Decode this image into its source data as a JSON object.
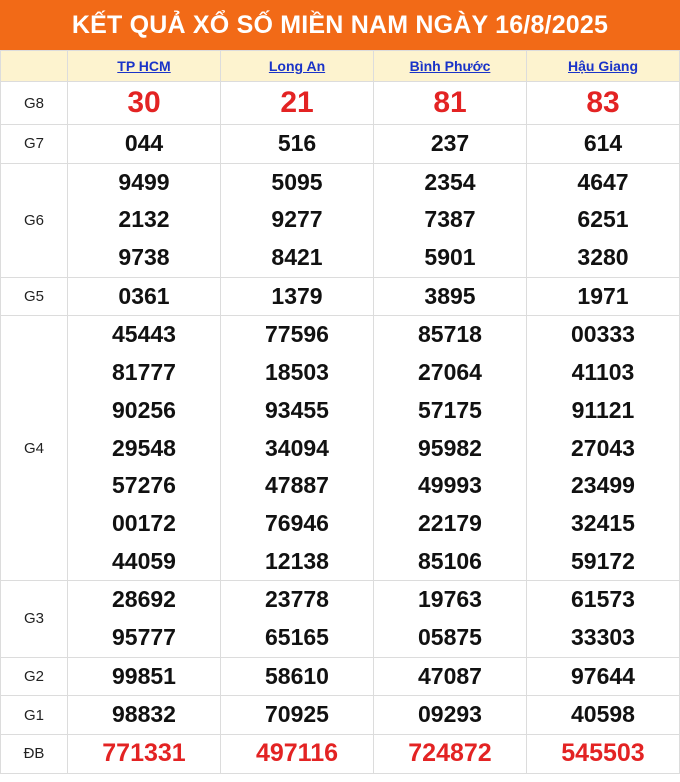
{
  "title": "KẾT QUẢ XỔ SỐ MIỀN NAM NGÀY 16/8/2025",
  "provinces": [
    "TP HCM",
    "Long An",
    "Bình Phước",
    "Hậu Giang"
  ],
  "colors": {
    "banner": "#f26a17",
    "header_bg": "#fdf3cf",
    "link": "#1a33c8",
    "highlight": "#e32323"
  },
  "prizes": [
    {
      "label": "G8",
      "values": [
        [
          "30"
        ],
        [
          "21"
        ],
        [
          "81"
        ],
        [
          "83"
        ]
      ]
    },
    {
      "label": "G7",
      "values": [
        [
          "044"
        ],
        [
          "516"
        ],
        [
          "237"
        ],
        [
          "614"
        ]
      ]
    },
    {
      "label": "G6",
      "values": [
        [
          "9499",
          "2132",
          "9738"
        ],
        [
          "5095",
          "9277",
          "8421"
        ],
        [
          "2354",
          "7387",
          "5901"
        ],
        [
          "4647",
          "6251",
          "3280"
        ]
      ]
    },
    {
      "label": "G5",
      "values": [
        [
          "0361"
        ],
        [
          "1379"
        ],
        [
          "3895"
        ],
        [
          "1971"
        ]
      ]
    },
    {
      "label": "G4",
      "values": [
        [
          "45443",
          "81777",
          "90256",
          "29548",
          "57276",
          "00172",
          "44059"
        ],
        [
          "77596",
          "18503",
          "93455",
          "34094",
          "47887",
          "76946",
          "12138"
        ],
        [
          "85718",
          "27064",
          "57175",
          "95982",
          "49993",
          "22179",
          "85106"
        ],
        [
          "00333",
          "41103",
          "91121",
          "27043",
          "23499",
          "32415",
          "59172"
        ]
      ]
    },
    {
      "label": "G3",
      "values": [
        [
          "28692",
          "95777"
        ],
        [
          "23778",
          "65165"
        ],
        [
          "19763",
          "05875"
        ],
        [
          "61573",
          "33303"
        ]
      ]
    },
    {
      "label": "G2",
      "values": [
        [
          "99851"
        ],
        [
          "58610"
        ],
        [
          "47087"
        ],
        [
          "97644"
        ]
      ]
    },
    {
      "label": "G1",
      "values": [
        [
          "98832"
        ],
        [
          "70925"
        ],
        [
          "09293"
        ],
        [
          "40598"
        ]
      ]
    },
    {
      "label": "ĐB",
      "values": [
        [
          "771331"
        ],
        [
          "497116"
        ],
        [
          "724872"
        ],
        [
          "545503"
        ]
      ]
    }
  ]
}
